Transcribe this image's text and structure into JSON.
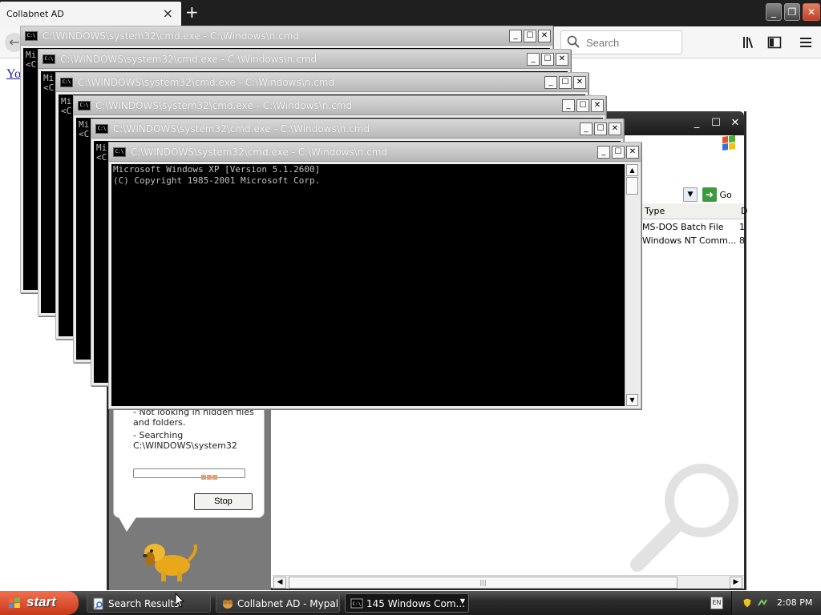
{
  "browser": {
    "tab_title": "Collabnet AD",
    "tab_close": "×",
    "new_tab": "+",
    "search_placeholder": "Search",
    "page_link": "Yo"
  },
  "explorer": {
    "address_go": "Go",
    "columns": {
      "type": "Type",
      "d": "D"
    },
    "files": [
      {
        "type": "MS-DOS Batch File",
        "size": "1"
      },
      {
        "type": "Windows NT Comm...",
        "size": "8"
      }
    ],
    "search_status": {
      "line1": "- Not looking in hidden files",
      "line2": "and folders.",
      "line3": "- Searching",
      "line4": "C:\\WINDOWS\\system32"
    },
    "stop_label": "Stop"
  },
  "cmd": {
    "title": "C:\\WINDOWS\\system32\\cmd.exe - C:\\Windows\\n.cmd",
    "peek_text": "Mi\n<C",
    "output_lines": [
      "Microsoft Windows XP [Version 5.1.2600]",
      "(C) Copyright 1985-2001 Microsoft Corp."
    ]
  },
  "taskbar": {
    "start_label": "start",
    "buttons": [
      {
        "label": "Search Results",
        "icon": "search-results-icon"
      },
      {
        "label": "Collabnet AD - Mypal",
        "icon": "mypal-browser-icon"
      },
      {
        "label": "145 Windows Com...",
        "icon": "command-prompt-icon"
      }
    ],
    "ime_label": "EN",
    "clock": "2:08 PM"
  },
  "colors": {
    "taskbar_dark": "#1c1c1c",
    "start_orange": "#d84a28",
    "cmd_background": "#000000",
    "link_blue": "#1a1aa6"
  }
}
